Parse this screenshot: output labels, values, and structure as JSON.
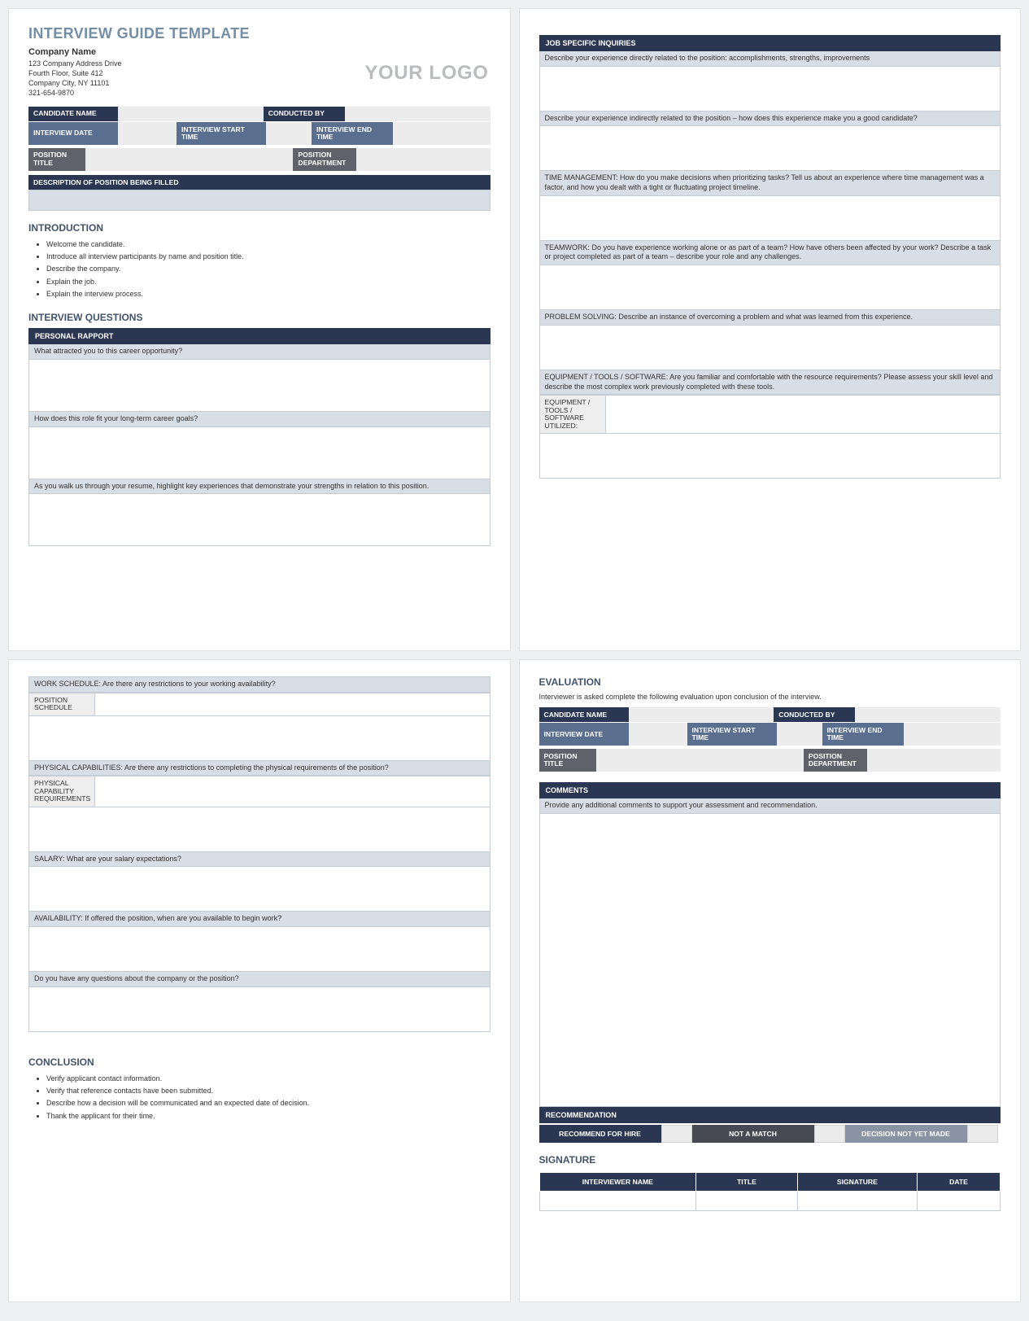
{
  "header": {
    "title": "INTERVIEW GUIDE TEMPLATE",
    "company_name": "Company Name",
    "address1": "123 Company Address Drive",
    "address2": "Fourth Floor, Suite 412",
    "city_line": "Company City, NY  11101",
    "phone": "321-654-9870",
    "logo_text": "YOUR LOGO"
  },
  "form": {
    "candidate_name": "CANDIDATE NAME",
    "conducted_by": "CONDUCTED BY",
    "interview_date": "INTERVIEW DATE",
    "start_time": "INTERVIEW START TIME",
    "end_time": "INTERVIEW END TIME",
    "position_title": "POSITION TITLE",
    "position_dept": "POSITION DEPARTMENT",
    "desc_label": "DESCRIPTION OF POSITION BEING FILLED"
  },
  "intro": {
    "heading": "INTRODUCTION",
    "items": [
      "Welcome the candidate.",
      "Introduce all interview participants by name and position title.",
      "Describe the company.",
      "Explain the job.",
      "Explain the interview process."
    ]
  },
  "iq_heading": "INTERVIEW QUESTIONS",
  "rapport": {
    "header": "PERSONAL RAPPORT",
    "q1": "What attracted you to this career opportunity?",
    "q2": "How does this role fit your long-term career goals?",
    "q3": "As you walk us through your resume, highlight key experiences that demonstrate your strengths in relation to this position."
  },
  "job": {
    "header": "JOB SPECIFIC INQUIRIES",
    "q1": "Describe your experience directly related to the position: accomplishments, strengths, improvements",
    "q2": "Describe your experience indirectly related to the position – how does this experience make you a good candidate?",
    "q3": "TIME MANAGEMENT: How do you make decisions when prioritizing tasks? Tell us about an experience where time management was a factor, and how you dealt with a tight or fluctuating project timeline.",
    "q4": "TEAMWORK: Do you have experience working alone or as part of a team? How have others been affected by your work? Describe a task or project completed as part of a team – describe your role and any challenges.",
    "q5": "PROBLEM SOLVING: Describe an instance of overcoming a problem and what was learned from this experience.",
    "q6": "EQUIPMENT / TOOLS / SOFTWARE: Are you familiar and comfortable with the resource requirements? Please assess your skill level and describe the most complex work previously completed with these tools.",
    "q6_sub": "EQUIPMENT / TOOLS / SOFTWARE UTILIZED:"
  },
  "page3": {
    "q1": "WORK SCHEDULE: Are there any restrictions to your working availability?",
    "q1_sub": "POSITION SCHEDULE",
    "q2": "PHYSICAL CAPABILITIES: Are there any restrictions to completing the physical requirements of the position?",
    "q2_sub": "PHYSICAL CAPABILITY REQUIREMENTS",
    "q3": "SALARY: What are your salary expectations?",
    "q4": "AVAILABILITY:  If offered the position, when are you available to begin work?",
    "q5": "Do you have any questions about the company or the position?"
  },
  "conclusion": {
    "heading": "CONCLUSION",
    "items": [
      "Verify applicant contact information.",
      "Verify that reference contacts have been submitted.",
      "Describe how a decision will be communicated and an expected date of decision.",
      "Thank the applicant for their time."
    ]
  },
  "eval": {
    "heading": "EVALUATION",
    "note": "Interviewer is asked complete the following evaluation upon conclusion of the interview.",
    "comments_header": "COMMENTS",
    "comments_prompt": "Provide any additional comments to support your assessment and recommendation.",
    "rec_header": "RECOMMENDATION",
    "rec1": "RECOMMEND FOR HIRE",
    "rec2": "NOT A MATCH",
    "rec3": "DECISION NOT YET MADE",
    "sig_heading": "SIGNATURE",
    "sig_cols": [
      "INTERVIEWER NAME",
      "TITLE",
      "SIGNATURE",
      "DATE"
    ]
  }
}
